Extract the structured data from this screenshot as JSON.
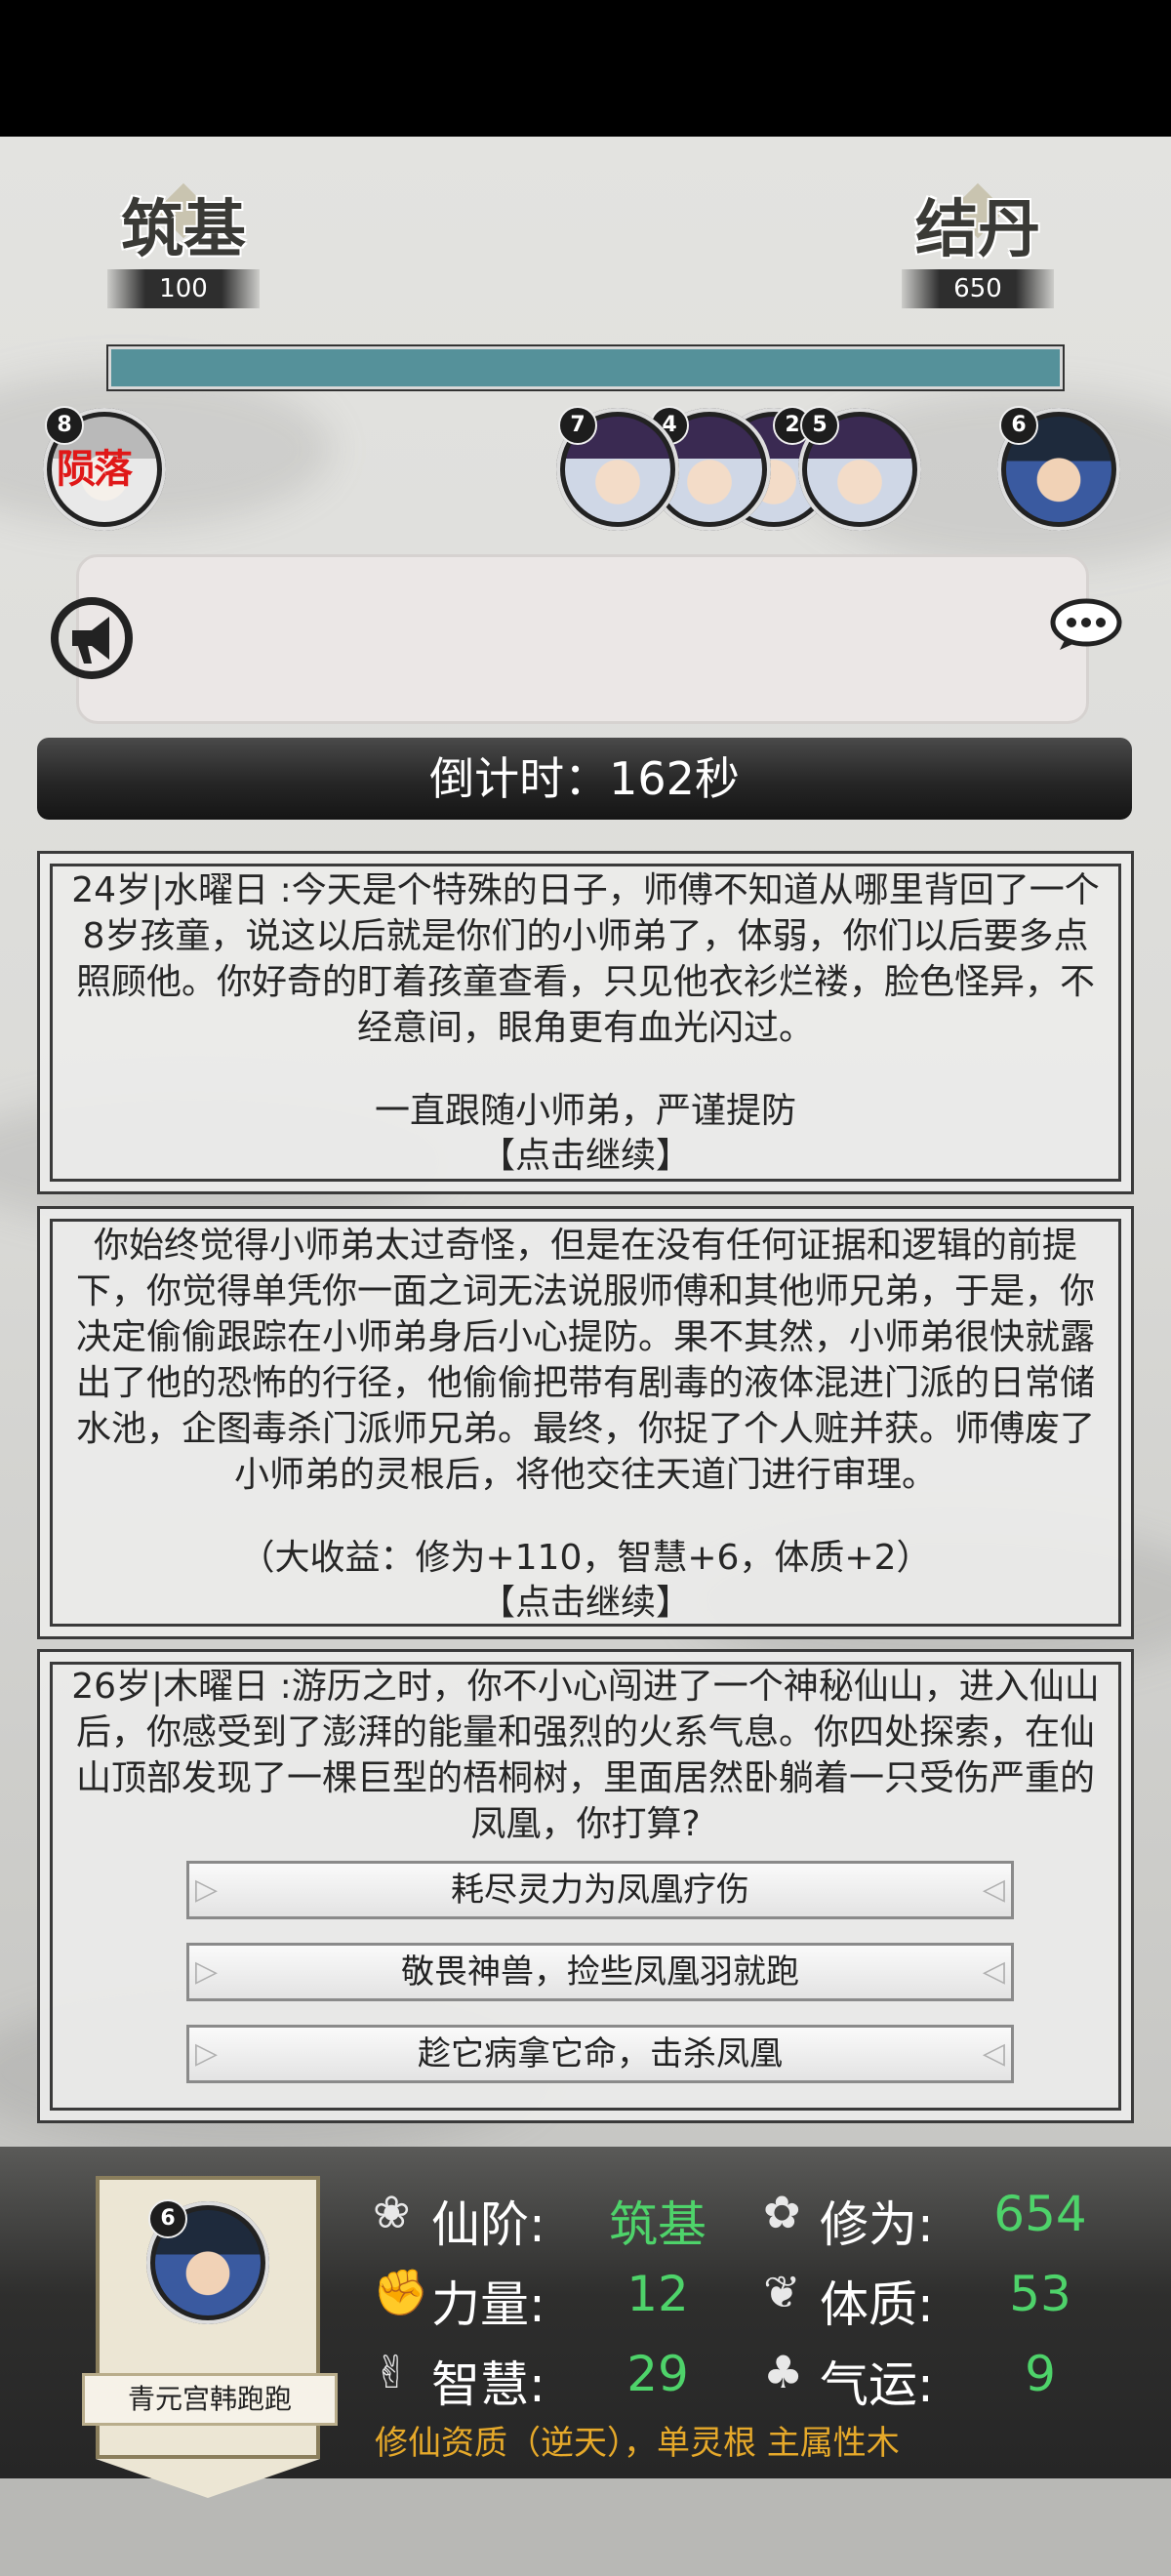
{
  "realm": {
    "current": {
      "name": "筑基",
      "value": "100"
    },
    "next": {
      "name": "结丹",
      "value": "650"
    },
    "progress_fraction": 1.0,
    "bar_color": "#55919a"
  },
  "avatars": [
    {
      "badge": "8",
      "status": "陨落"
    },
    {
      "badge": "7"
    },
    {
      "badge": "4"
    },
    {
      "badge": "2"
    },
    {
      "badge": "5"
    },
    {
      "badge": "6"
    }
  ],
  "icons": {
    "announce": "megaphone-icon",
    "chat": "speech-bubble-icon"
  },
  "countdown": "倒计时：162秒",
  "events": [
    {
      "text": "24岁|水曜日 :今天是个特殊的日子，师傅不知道从哪里背回了一个8岁孩童，说这以后就是你们的小师弟了，体弱，你们以后要多点照顾他。你好奇的盯着孩童查看，只见他衣衫烂褛，脸色怪异，不经意间，眼角更有血光闪过。",
      "choice": "一直跟随小师弟，严谨提防",
      "continue": "【点击继续】"
    },
    {
      "text": "你始终觉得小师弟太过奇怪，但是在没有任何证据和逻辑的前提下，你觉得单凭你一面之词无法说服师傅和其他师兄弟，于是，你决定偷偷跟踪在小师弟身后小心提防。果不其然，小师弟很快就露出了他的恐怖的行径，他偷偷把带有剧毒的液体混进门派的日常储水池，企图毒杀门派师兄弟。最终，你捉了个人赃并获。师傅废了小师弟的灵根后，将他交往天道门进行审理。",
      "reward": "（大收益：修为+110，智慧+6，体质+2）",
      "continue": "【点击继续】"
    },
    {
      "text": "26岁|木曜日 :游历之时，你不小心闯进了一个神秘仙山，进入仙山后，你感受到了澎湃的能量和强烈的火系气息。你四处探索，在仙山顶部发现了一棵巨型的梧桐树，里面居然卧躺着一只受伤严重的凤凰，你打算?",
      "options": [
        "耗尽灵力为凤凰疗伤",
        "敬畏神兽，捡些凤凰羽就跑",
        "趁它病拿它命，击杀凤凰"
      ]
    }
  ],
  "character": {
    "badge": "6",
    "name": "青元宫韩跑跑",
    "stats": [
      {
        "icon": "lotus-icon",
        "label": "仙阶:",
        "value": "筑基"
      },
      {
        "icon": "swirl-icon",
        "label": "修为:",
        "value": "654"
      },
      {
        "icon": "fist-icon",
        "label": "力量:",
        "value": "12"
      },
      {
        "icon": "leaf-icon",
        "label": "体质:",
        "value": "53"
      },
      {
        "icon": "hand-sign-icon",
        "label": "智慧:",
        "value": "29"
      },
      {
        "icon": "clover-icon",
        "label": "气运:",
        "value": "9"
      }
    ],
    "aptitude": "修仙资质（逆天），单灵根 主属性木"
  },
  "colors": {
    "stat_value": "#4ed36a",
    "highlight": "#f0921a",
    "aptitude": "#e6a92a",
    "fallen": "#e01818"
  }
}
